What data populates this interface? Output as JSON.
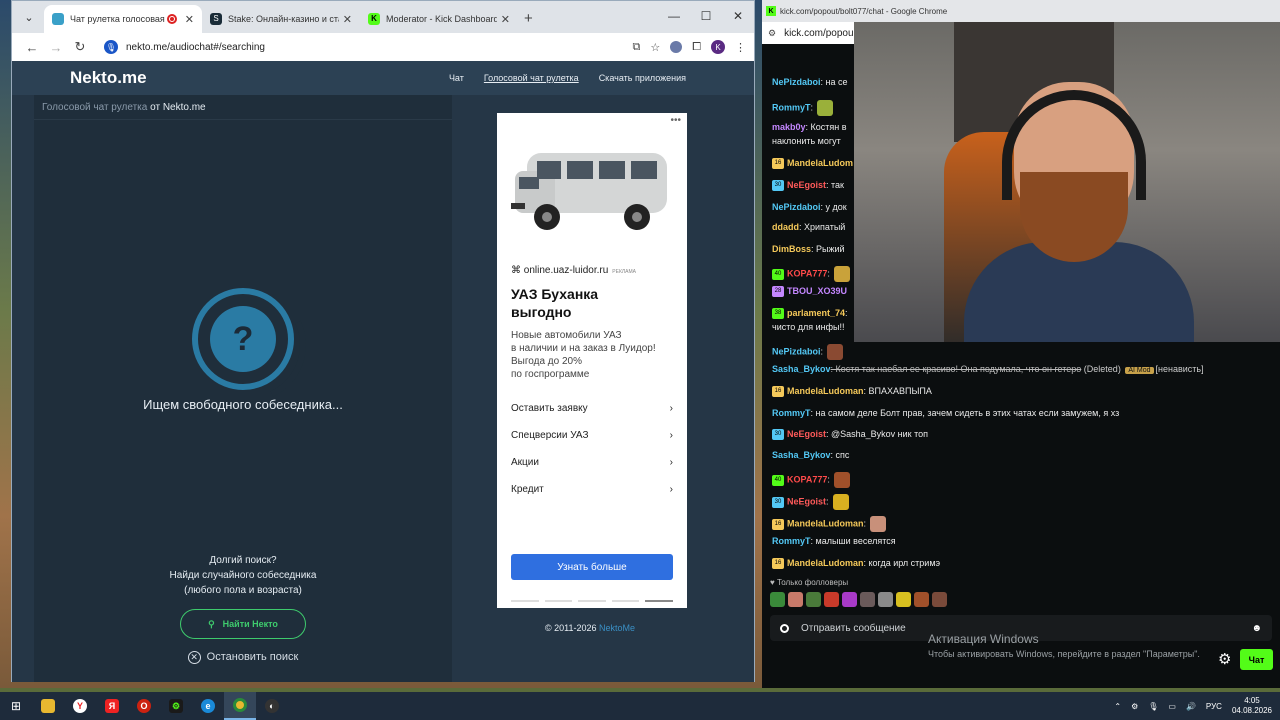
{
  "left_window": {
    "tabs": [
      {
        "title": "Чат рулетка голосовая —",
        "active": true
      },
      {
        "title": "Stake: Онлайн-казино и ставк",
        "active": false
      },
      {
        "title": "Moderator - Kick Dashboard",
        "active": false
      }
    ],
    "url": "nekto.me/audiochat#/searching"
  },
  "site": {
    "logo": "Nekto.me",
    "nav": [
      "Чат",
      "Голосовой чат рулетка",
      "Скачать приложения"
    ],
    "crumb_link": "Голосовой чат рулетка",
    "crumb_rest": "от Nekto.me",
    "searching": "Ищем свободного собеседника...",
    "long_search": [
      "Долгий поиск?",
      "Найди случайного собеседника",
      "(любого пола и возраста)"
    ],
    "find_button": "Найти Некто",
    "stop_button": "Остановить поиск",
    "copyright_prefix": "© 2011-2026",
    "copyright_link": "NektoMe"
  },
  "ad": {
    "domain": "online.uaz-luidor.ru",
    "ad_label": "РЕКЛАМА",
    "title_1": "УАЗ Буханка",
    "title_2": "выгодно",
    "desc": [
      "Новые автомобили УАЗ",
      "в наличии и на заказ в Луидор!",
      "Выгода до 20%",
      "по госпрограмме"
    ],
    "links": [
      "Оставить заявку",
      "Спецверсии УАЗ",
      "Акции",
      "Кредит"
    ],
    "button": "Узнать больше"
  },
  "right_window": {
    "title": "kick.com/popout/bolt077/chat - Google Chrome",
    "url": "kick.com/popou"
  },
  "chat": [
    {
      "user": "NePizdaboi",
      "color": "#53c8f5",
      "text": ": на се",
      "badge": ""
    },
    {
      "user": "RommyT",
      "color": "#53c8f5",
      "text": ":",
      "badge": "",
      "emote": "#9ab03a"
    },
    {
      "user": "makb0y",
      "color": "#c487ff",
      "text": ": Костян в",
      "badge": ""
    },
    {
      "user": "",
      "color": "#eaeaea",
      "text": "наклонить могут",
      "badge": ""
    },
    {
      "user": "MandelaLudom",
      "color": "#f5c95a",
      "text": "",
      "badge": "16"
    },
    {
      "user": "NeEgoist",
      "color": "#ff5a5a",
      "text": ": так",
      "badge": "30"
    },
    {
      "user": "NePizdaboi",
      "color": "#53c8f5",
      "text": ": у док",
      "badge": ""
    },
    {
      "user": "ddadd",
      "color": "#f5c95a",
      "text": ": Хрипатый",
      "badge": ""
    },
    {
      "user": "DimBoss",
      "color": "#f5c95a",
      "text": ": Рыжий",
      "badge": ""
    },
    {
      "user": "KOPA777",
      "color": "#ff4a4a",
      "text": ":",
      "badge": "40",
      "emote": "#c9a23a"
    },
    {
      "user": "TBOU_XO39U",
      "color": "#c487ff",
      "text": "",
      "badge": "28"
    },
    {
      "user": "parlament_74",
      "color": "#f5c95a",
      "text": ":",
      "badge": "38"
    },
    {
      "user": "",
      "color": "#eaeaea",
      "text": "чисто для инфы!!",
      "badge": ""
    },
    {
      "user": "NePizdaboi",
      "color": "#53c8f5",
      "text": ":",
      "badge": "",
      "emote": "#8a4a32"
    },
    {
      "user": "Sasha_Bykov",
      "color": "#53c8f5",
      "text": ": Костя так наебал ее красиво! Она подумала, что он гетеро",
      "badge": "",
      "strike": true,
      "deleted": "(Deleted)",
      "mod": "AI Mod",
      "tail": "[ненависть]"
    },
    {
      "user": "MandelaLudoman",
      "color": "#f5c95a",
      "text": ": ВПАХАВПЫПА",
      "badge": "16"
    },
    {
      "user": "RommyT",
      "color": "#53c8f5",
      "text": ": на самом деле Болт прав, зачем сидеть в этих чатах если замужем, я хз",
      "badge": ""
    },
    {
      "user": "NeEgoist",
      "color": "#ff5a5a",
      "text": ": @Sasha_Bykov ник топ",
      "badge": "30"
    },
    {
      "user": "Sasha_Bykov",
      "color": "#53c8f5",
      "text": ": спс",
      "badge": ""
    },
    {
      "user": "KOPA777",
      "color": "#ff4a4a",
      "text": ":",
      "badge": "40",
      "emote": "#a0502a"
    },
    {
      "user": "NeEgoist",
      "color": "#ff5a5a",
      "text": ":",
      "badge": "30",
      "emote": "#d8b020"
    },
    {
      "user": "MandelaLudoman",
      "color": "#f5c95a",
      "text": ":",
      "badge": "16",
      "emote": "#c8907a"
    },
    {
      "user": "RommyT",
      "color": "#53c8f5",
      "text": ": малыши веселятся",
      "badge": ""
    },
    {
      "user": "MandelaLudoman",
      "color": "#f5c95a",
      "text": ": когда ирл стримэ",
      "badge": "16"
    }
  ],
  "chat_footer": {
    "followers_only": "Только фолловеры",
    "input_placeholder": "Отправить сообщение",
    "chat_button": "Чат"
  },
  "windows_activation": {
    "line1": "Активация Windows",
    "line2": "Чтобы активировать Windows, перейдите в раздел \"Параметры\"."
  },
  "taskbar": {
    "lang": "РУС",
    "time": "4:05",
    "date": "04.08.2026"
  },
  "colors": {
    "kick_green": "#53fc18",
    "nekto_green": "#3ecb6d",
    "ad_blue": "#2f6fe0"
  }
}
